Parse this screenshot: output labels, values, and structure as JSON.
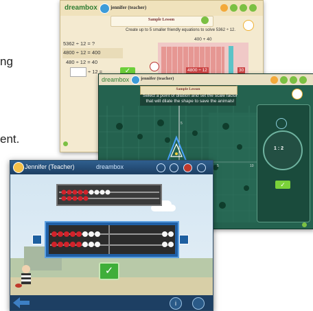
{
  "background_text": {
    "fragment_1": "ng",
    "fragment_2": "ent."
  },
  "screen_back": {
    "logo": "dreambox",
    "user": "jennifer (teacher)",
    "lesson_title": "Sample Lesson",
    "prompt": "Create up to 5 smaller friendly equations to solve 5362 ÷ 12.",
    "equations": [
      "5362 ÷ 12 = ?",
      "4800 ÷ 12 = 400",
      "480 ÷ 12 = 40",
      "÷ 12 ="
    ],
    "grid_label": "400 + 40",
    "bottom_labels": [
      "4800 ÷ 12",
      "30"
    ],
    "check": "✓"
  },
  "screen_middle": {
    "logo": "dreambox",
    "user": "jennifer (teacher)",
    "lesson_title": "Sample Lesson",
    "instruction_line1": "Select a point of dilation and set the scale factor",
    "instruction_line2": "that will dilate the shape to save the animals!",
    "axis_ticks": [
      "-5",
      "5",
      "10",
      "5"
    ],
    "dial_label": "1 : 2",
    "check": "✓"
  },
  "screen_front": {
    "user": "Jennifer (Teacher)",
    "logo": "dreambox",
    "check": "✓",
    "info_icon_label": "i",
    "colors": {
      "accent": "#1d3f63",
      "bead_red": "#d2222a",
      "check_green": "#3fae3a"
    }
  }
}
